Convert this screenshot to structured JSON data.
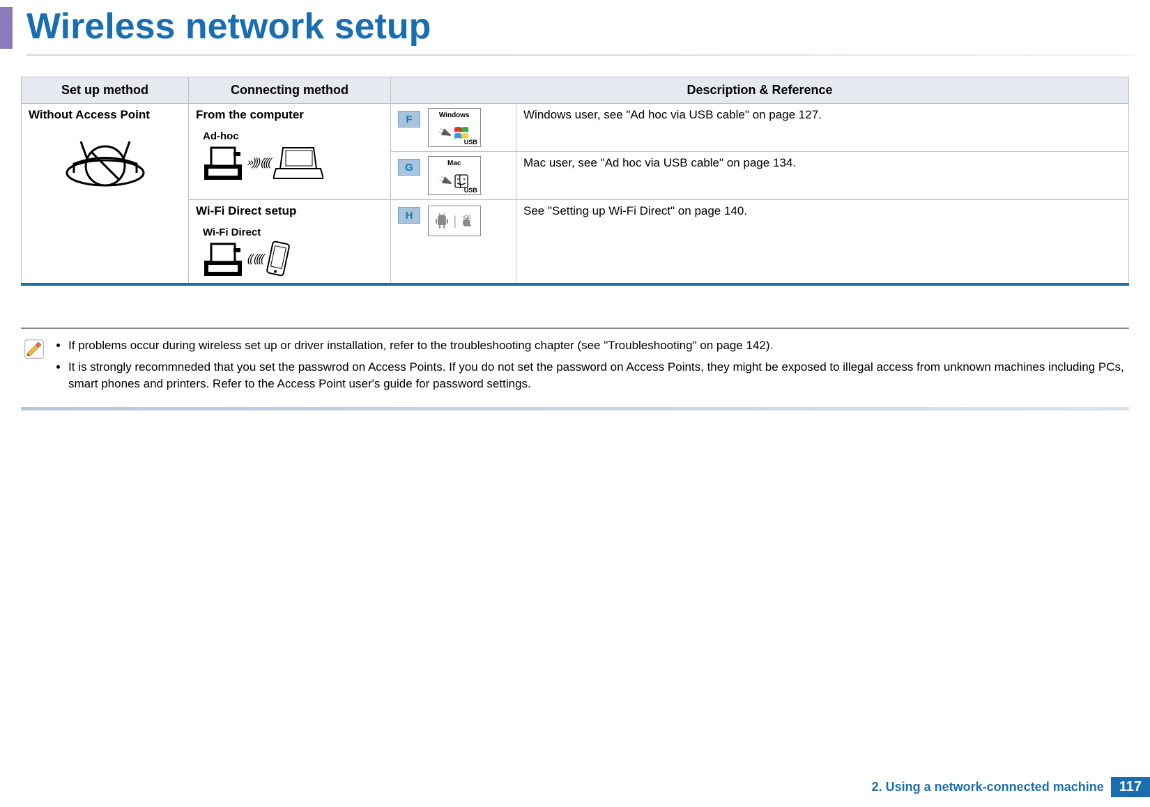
{
  "title": "Wireless network setup",
  "table": {
    "headers": [
      "Set up method",
      "Connecting method",
      "Description & Reference"
    ],
    "setup_method": "Without Access Point",
    "connecting": {
      "from_computer": "From the computer",
      "adhoc_label": "Ad-hoc",
      "wifi_direct_setup": "Wi-Fi Direct setup",
      "wifi_direct_label": "Wi-Fi Direct"
    },
    "rows": [
      {
        "tag": "F",
        "os_name": "Windows",
        "usb": "USB",
        "desc": "Windows user, see \"Ad hoc via USB cable\" on page 127."
      },
      {
        "tag": "G",
        "os_name": "Mac",
        "usb": "USB",
        "desc": "Mac user, see \"Ad hoc via USB cable\" on page 134."
      },
      {
        "tag": "H",
        "mobile_os": "android | iOS",
        "desc": "See \"Setting up Wi-Fi Direct\" on page 140."
      }
    ]
  },
  "notes": [
    "If problems occur during wireless set up or driver installation, refer to the troubleshooting chapter (see \"Troubleshooting\" on page 142).",
    "It is strongly recommneded that you set the passwrod on Access Points. If you do not set the password on Access Points, they might be exposed to illegal access from unknown machines including PCs, smart phones and printers. Refer to the Access Point user's guide for password settings."
  ],
  "footer": {
    "chapter": "2.  Using a network-connected machine",
    "page": "117"
  }
}
